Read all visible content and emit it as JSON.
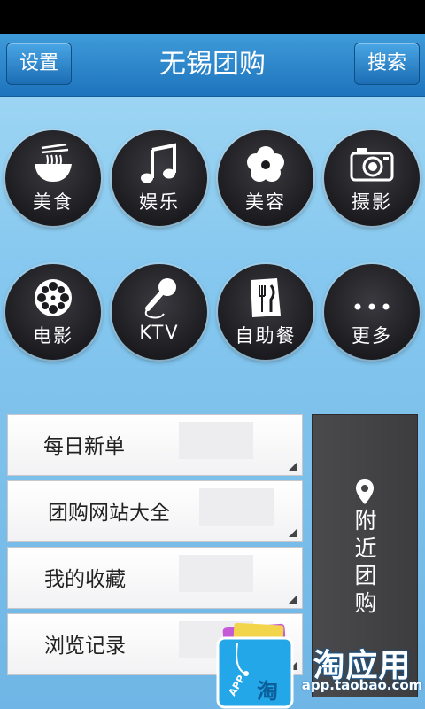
{
  "header": {
    "settings_label": "设置",
    "title": "无锡团购",
    "search_label": "搜索"
  },
  "categories": [
    {
      "label": "美食",
      "icon": "noodle-bowl-icon"
    },
    {
      "label": "娱乐",
      "icon": "music-note-icon"
    },
    {
      "label": "美容",
      "icon": "flower-icon"
    },
    {
      "label": "摄影",
      "icon": "camera-icon"
    },
    {
      "label": "电影",
      "icon": "film-reel-icon"
    },
    {
      "label": "KTV",
      "icon": "microphone-icon"
    },
    {
      "label": "自助餐",
      "icon": "menu-fork-knife-icon"
    },
    {
      "label": "更多",
      "icon": "more-dots-icon"
    }
  ],
  "menu": [
    {
      "label": "每日新单"
    },
    {
      "label": "团购网站大全"
    },
    {
      "label": "我的收藏"
    },
    {
      "label": "浏览记录"
    }
  ],
  "nearby": {
    "chars": [
      "附",
      "近",
      "团",
      "购"
    ],
    "icon": "location-pin-icon"
  },
  "brand": {
    "name": "淘应用",
    "url": "app.taobao.com",
    "logo_icon": "shopping-bag-icon",
    "logo_text_app": "APP",
    "logo_text_tao": "淘"
  },
  "colors": {
    "header": "#2a85cc",
    "background": "#86c8ef",
    "category_circle": "#1c1c20",
    "nearby_panel": "#444446"
  }
}
